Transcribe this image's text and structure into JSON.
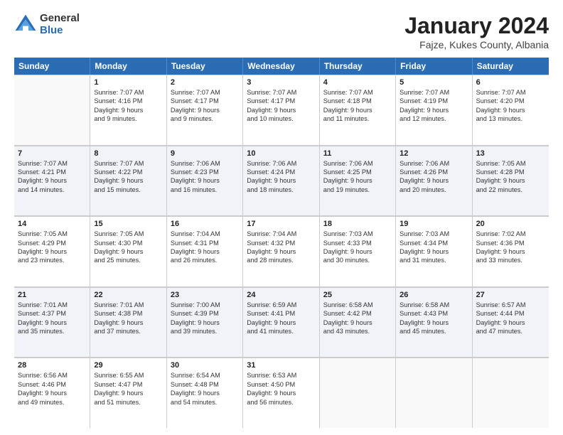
{
  "logo": {
    "general": "General",
    "blue": "Blue"
  },
  "title": "January 2024",
  "subtitle": "Fajze, Kukes County, Albania",
  "header_days": [
    "Sunday",
    "Monday",
    "Tuesday",
    "Wednesday",
    "Thursday",
    "Friday",
    "Saturday"
  ],
  "weeks": [
    {
      "alt": false,
      "days": [
        {
          "num": "",
          "lines": []
        },
        {
          "num": "1",
          "lines": [
            "Sunrise: 7:07 AM",
            "Sunset: 4:16 PM",
            "Daylight: 9 hours",
            "and 9 minutes."
          ]
        },
        {
          "num": "2",
          "lines": [
            "Sunrise: 7:07 AM",
            "Sunset: 4:17 PM",
            "Daylight: 9 hours",
            "and 9 minutes."
          ]
        },
        {
          "num": "3",
          "lines": [
            "Sunrise: 7:07 AM",
            "Sunset: 4:17 PM",
            "Daylight: 9 hours",
            "and 10 minutes."
          ]
        },
        {
          "num": "4",
          "lines": [
            "Sunrise: 7:07 AM",
            "Sunset: 4:18 PM",
            "Daylight: 9 hours",
            "and 11 minutes."
          ]
        },
        {
          "num": "5",
          "lines": [
            "Sunrise: 7:07 AM",
            "Sunset: 4:19 PM",
            "Daylight: 9 hours",
            "and 12 minutes."
          ]
        },
        {
          "num": "6",
          "lines": [
            "Sunrise: 7:07 AM",
            "Sunset: 4:20 PM",
            "Daylight: 9 hours",
            "and 13 minutes."
          ]
        }
      ]
    },
    {
      "alt": true,
      "days": [
        {
          "num": "7",
          "lines": [
            "Sunrise: 7:07 AM",
            "Sunset: 4:21 PM",
            "Daylight: 9 hours",
            "and 14 minutes."
          ]
        },
        {
          "num": "8",
          "lines": [
            "Sunrise: 7:07 AM",
            "Sunset: 4:22 PM",
            "Daylight: 9 hours",
            "and 15 minutes."
          ]
        },
        {
          "num": "9",
          "lines": [
            "Sunrise: 7:06 AM",
            "Sunset: 4:23 PM",
            "Daylight: 9 hours",
            "and 16 minutes."
          ]
        },
        {
          "num": "10",
          "lines": [
            "Sunrise: 7:06 AM",
            "Sunset: 4:24 PM",
            "Daylight: 9 hours",
            "and 18 minutes."
          ]
        },
        {
          "num": "11",
          "lines": [
            "Sunrise: 7:06 AM",
            "Sunset: 4:25 PM",
            "Daylight: 9 hours",
            "and 19 minutes."
          ]
        },
        {
          "num": "12",
          "lines": [
            "Sunrise: 7:06 AM",
            "Sunset: 4:26 PM",
            "Daylight: 9 hours",
            "and 20 minutes."
          ]
        },
        {
          "num": "13",
          "lines": [
            "Sunrise: 7:05 AM",
            "Sunset: 4:28 PM",
            "Daylight: 9 hours",
            "and 22 minutes."
          ]
        }
      ]
    },
    {
      "alt": false,
      "days": [
        {
          "num": "14",
          "lines": [
            "Sunrise: 7:05 AM",
            "Sunset: 4:29 PM",
            "Daylight: 9 hours",
            "and 23 minutes."
          ]
        },
        {
          "num": "15",
          "lines": [
            "Sunrise: 7:05 AM",
            "Sunset: 4:30 PM",
            "Daylight: 9 hours",
            "and 25 minutes."
          ]
        },
        {
          "num": "16",
          "lines": [
            "Sunrise: 7:04 AM",
            "Sunset: 4:31 PM",
            "Daylight: 9 hours",
            "and 26 minutes."
          ]
        },
        {
          "num": "17",
          "lines": [
            "Sunrise: 7:04 AM",
            "Sunset: 4:32 PM",
            "Daylight: 9 hours",
            "and 28 minutes."
          ]
        },
        {
          "num": "18",
          "lines": [
            "Sunrise: 7:03 AM",
            "Sunset: 4:33 PM",
            "Daylight: 9 hours",
            "and 30 minutes."
          ]
        },
        {
          "num": "19",
          "lines": [
            "Sunrise: 7:03 AM",
            "Sunset: 4:34 PM",
            "Daylight: 9 hours",
            "and 31 minutes."
          ]
        },
        {
          "num": "20",
          "lines": [
            "Sunrise: 7:02 AM",
            "Sunset: 4:36 PM",
            "Daylight: 9 hours",
            "and 33 minutes."
          ]
        }
      ]
    },
    {
      "alt": true,
      "days": [
        {
          "num": "21",
          "lines": [
            "Sunrise: 7:01 AM",
            "Sunset: 4:37 PM",
            "Daylight: 9 hours",
            "and 35 minutes."
          ]
        },
        {
          "num": "22",
          "lines": [
            "Sunrise: 7:01 AM",
            "Sunset: 4:38 PM",
            "Daylight: 9 hours",
            "and 37 minutes."
          ]
        },
        {
          "num": "23",
          "lines": [
            "Sunrise: 7:00 AM",
            "Sunset: 4:39 PM",
            "Daylight: 9 hours",
            "and 39 minutes."
          ]
        },
        {
          "num": "24",
          "lines": [
            "Sunrise: 6:59 AM",
            "Sunset: 4:41 PM",
            "Daylight: 9 hours",
            "and 41 minutes."
          ]
        },
        {
          "num": "25",
          "lines": [
            "Sunrise: 6:58 AM",
            "Sunset: 4:42 PM",
            "Daylight: 9 hours",
            "and 43 minutes."
          ]
        },
        {
          "num": "26",
          "lines": [
            "Sunrise: 6:58 AM",
            "Sunset: 4:43 PM",
            "Daylight: 9 hours",
            "and 45 minutes."
          ]
        },
        {
          "num": "27",
          "lines": [
            "Sunrise: 6:57 AM",
            "Sunset: 4:44 PM",
            "Daylight: 9 hours",
            "and 47 minutes."
          ]
        }
      ]
    },
    {
      "alt": false,
      "days": [
        {
          "num": "28",
          "lines": [
            "Sunrise: 6:56 AM",
            "Sunset: 4:46 PM",
            "Daylight: 9 hours",
            "and 49 minutes."
          ]
        },
        {
          "num": "29",
          "lines": [
            "Sunrise: 6:55 AM",
            "Sunset: 4:47 PM",
            "Daylight: 9 hours",
            "and 51 minutes."
          ]
        },
        {
          "num": "30",
          "lines": [
            "Sunrise: 6:54 AM",
            "Sunset: 4:48 PM",
            "Daylight: 9 hours",
            "and 54 minutes."
          ]
        },
        {
          "num": "31",
          "lines": [
            "Sunrise: 6:53 AM",
            "Sunset: 4:50 PM",
            "Daylight: 9 hours",
            "and 56 minutes."
          ]
        },
        {
          "num": "",
          "lines": []
        },
        {
          "num": "",
          "lines": []
        },
        {
          "num": "",
          "lines": []
        }
      ]
    }
  ]
}
